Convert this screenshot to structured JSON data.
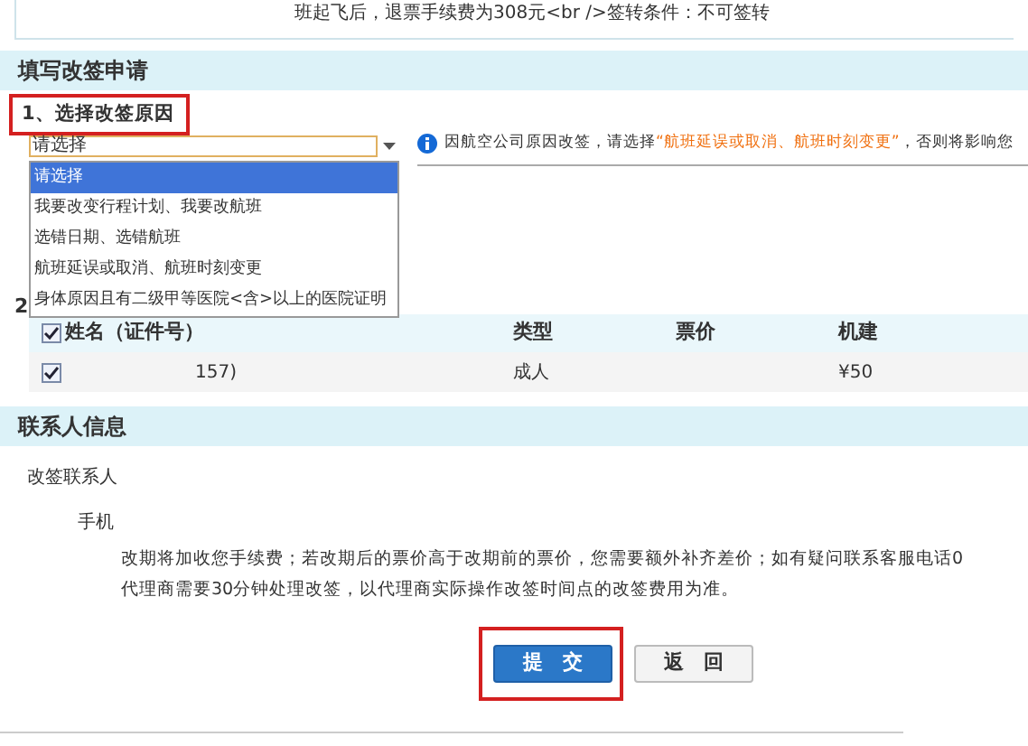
{
  "rules": {
    "text": "班起飞后，退票手续费为308元<br />签转条件：不可签转"
  },
  "apply_section": {
    "title": "填写改签申请",
    "step_1": {
      "label": "1、选择改签原因",
      "select_value": "请选择",
      "info": "因航空公司原因改签，请选择",
      "info_highlight": "“航班延误或取消、航班时刻变更”",
      "info_tail": "，否则将影响您",
      "options": [
        {
          "label": "请选择",
          "selected": true
        },
        {
          "label": "我要改变行程计划、我要改航班",
          "selected": false
        },
        {
          "label": "选错日期、选错航班",
          "selected": false
        },
        {
          "label": "航班延误或取消、航班时刻变更",
          "selected": false
        },
        {
          "label": "身体原因且有二级甲等医院<含>以上的医院证明",
          "selected": false
        }
      ]
    },
    "step_2": {
      "label": "2"
    },
    "table": {
      "columns": [
        {
          "label": "姓名（证件号）",
          "checked": true
        },
        {
          "label": "类型"
        },
        {
          "label": "票价"
        },
        {
          "label": "机建"
        }
      ],
      "rows": [
        {
          "checked": true,
          "cells": [
            "157)",
            "成人",
            "",
            "¥50"
          ]
        }
      ]
    }
  },
  "contact_section": {
    "title": "联系人信息",
    "contact_label": "改签联系人",
    "phone_label": "手机",
    "notice": [
      "改期将加收您手续费；若改期后的票价高于改期前的票价，您需要额外补齐差价；如有疑问联系客服电话0",
      "代理商需要30分钟处理改签，以代理商实际操作改签时间点的改签费用为准。"
    ]
  },
  "buttons": [
    {
      "label": "提　交",
      "kind": "primary"
    },
    {
      "label": "返　回",
      "kind": "secondary"
    }
  ]
}
